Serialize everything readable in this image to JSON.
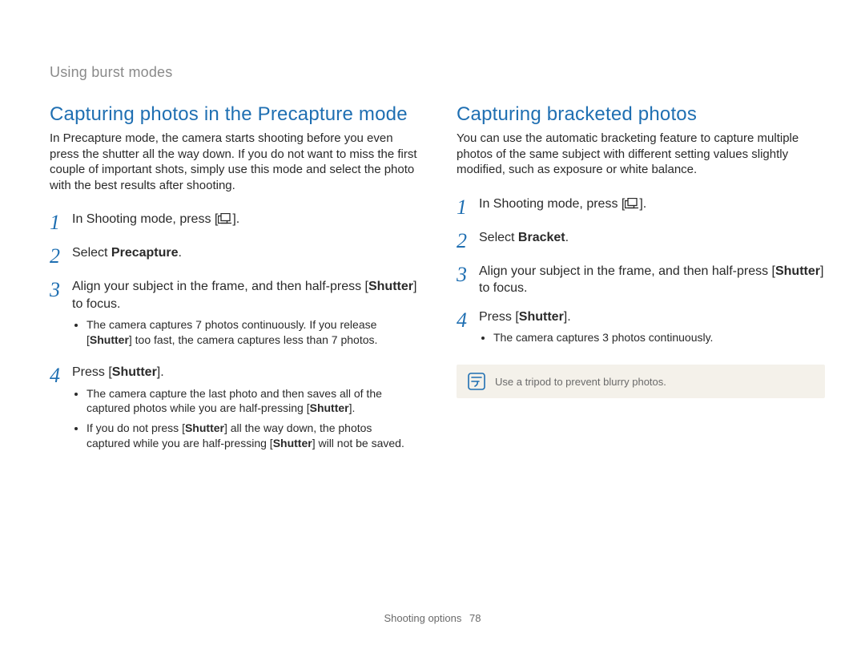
{
  "breadcrumb": "Using burst modes",
  "left": {
    "title": "Capturing photos in the Precapture mode",
    "intro": "In Precapture mode, the camera starts shooting before you even press the shutter all the way down. If you do not want to miss the first couple of important shots, simply use this mode and select the photo with the best results after shooting.",
    "steps": {
      "s1_pre": "In Shooting mode, press [",
      "s1_post": "].",
      "s2_pre": "Select ",
      "s2_bold": "Precapture",
      "s2_post": ".",
      "s3_pre": "Align your subject in the frame, and then half-press [",
      "s3_bold": "Shutter",
      "s3_post": "] to focus.",
      "s3_b1_a": "The camera captures 7 photos continuously. If you release [",
      "s3_b1_bold": "Shutter",
      "s3_b1_b": "] too fast, the camera captures less than 7 photos.",
      "s4_pre": "Press [",
      "s4_bold": "Shutter",
      "s4_post": "].",
      "s4_b1_a": "The camera capture the last photo and then saves all of the captured photos while you are half-pressing [",
      "s4_b1_bold": "Shutter",
      "s4_b1_b": "].",
      "s4_b2_a": "If you do not press [",
      "s4_b2_bold1": "Shutter",
      "s4_b2_b": "] all the way down, the photos captured while you are half-pressing [",
      "s4_b2_bold2": "Shutter",
      "s4_b2_c": "] will not be saved."
    }
  },
  "right": {
    "title": "Capturing bracketed photos",
    "intro": "You can use the automatic bracketing feature to capture multiple photos of the same subject with different setting values slightly modified, such as exposure or white balance.",
    "steps": {
      "s1_pre": "In Shooting mode, press [",
      "s1_post": "].",
      "s2_pre": "Select ",
      "s2_bold": "Bracket",
      "s2_post": ".",
      "s3_pre": "Align your subject in the frame, and then half-press [",
      "s3_bold": "Shutter",
      "s3_post": "] to focus.",
      "s4_pre": "Press [",
      "s4_bold": "Shutter",
      "s4_post": "].",
      "s4_b1": "The camera captures 3 photos continuously."
    },
    "note": "Use a tripod to prevent blurry photos."
  },
  "footer": {
    "section": "Shooting options",
    "page": "78"
  },
  "icons": {
    "burst": "burst-mode-icon",
    "note": "note-icon"
  }
}
